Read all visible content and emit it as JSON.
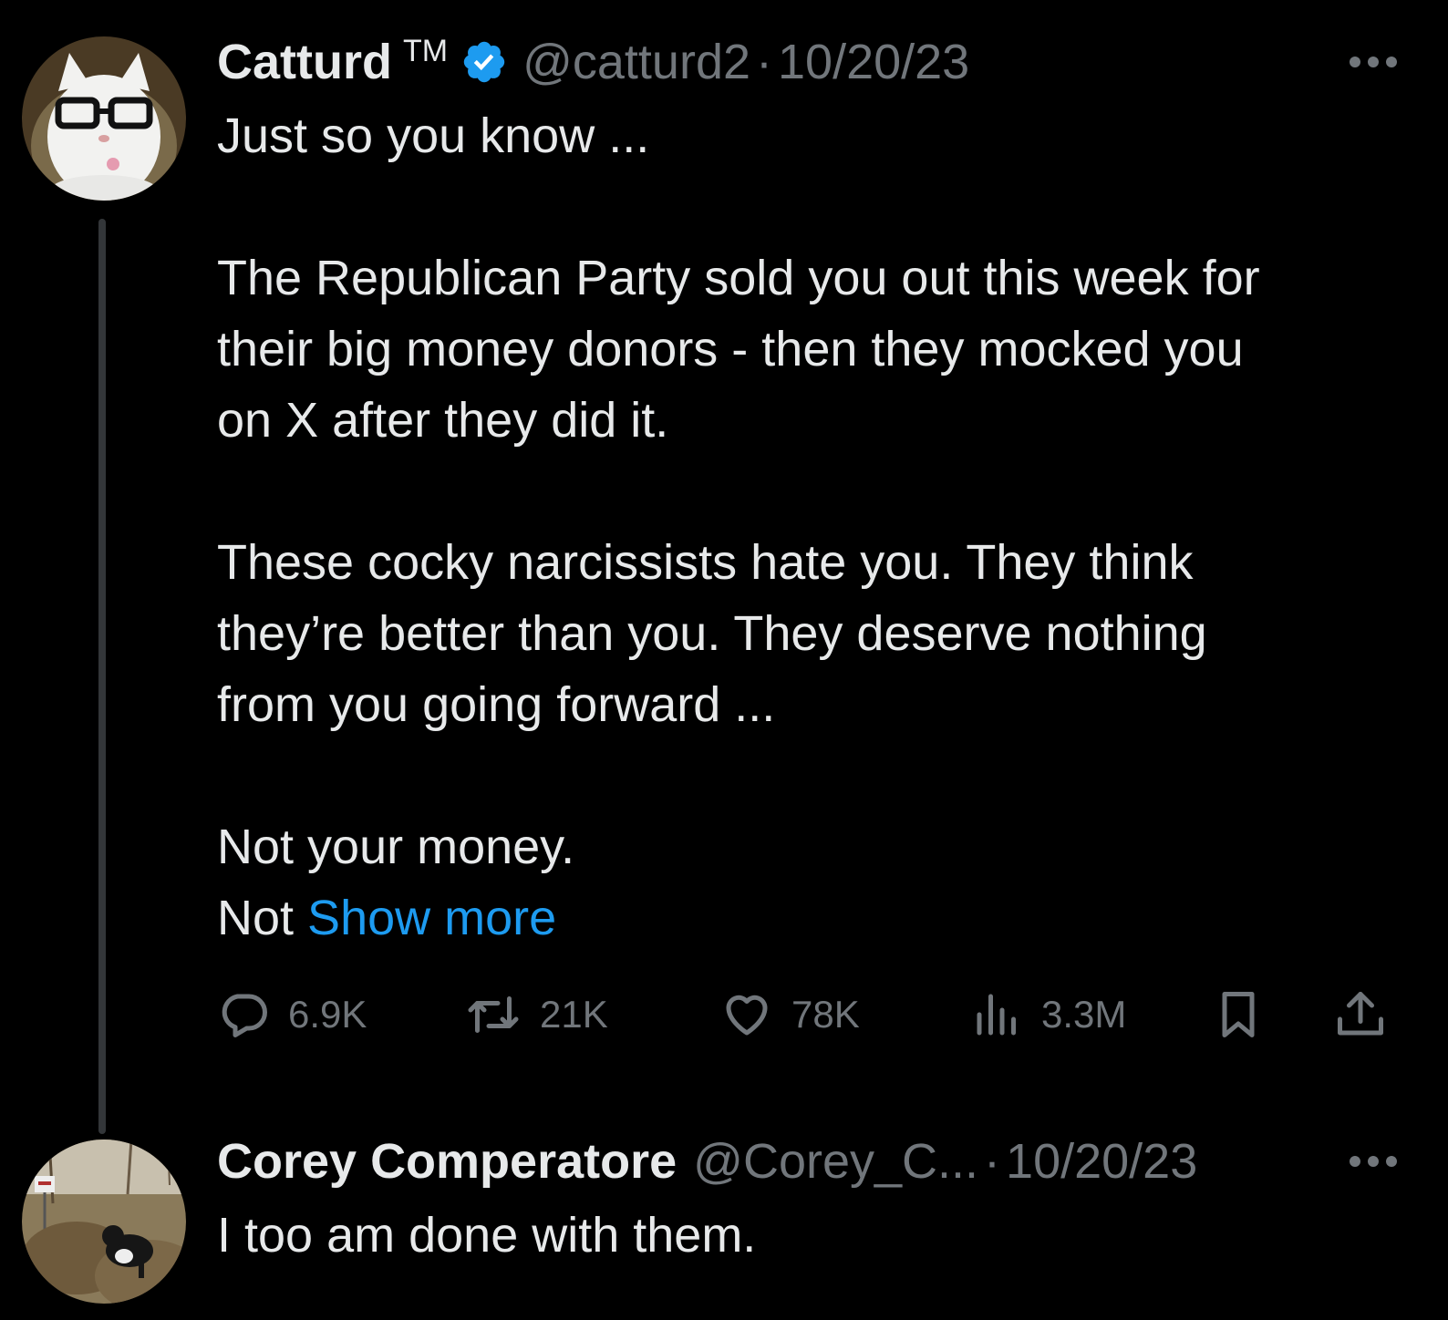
{
  "tweet": {
    "display_name": "Catturd",
    "trademark": "TM",
    "handle": "@catturd2",
    "separator": "·",
    "date": "10/20/23",
    "lines": [
      "Just so you know ...",
      "",
      "The Republican Party sold you out this week for",
      "their big money donors -  then they mocked you",
      "on X after they did it.",
      "",
      "These cocky narcissists hate you. They think",
      "they’re better than you. They deserve nothing",
      "from you going forward ...",
      "",
      "Not your money."
    ],
    "last_line_prefix": "Not ",
    "show_more": "Show more",
    "replies": "6.9K",
    "reposts": "21K",
    "likes": "78K",
    "views": "3.3M"
  },
  "reply": {
    "display_name": "Corey Comperatore",
    "handle": "@Corey_C...",
    "separator": "·",
    "date": "10/20/23",
    "text": "I too am done with them."
  },
  "colors": {
    "background": "#000000",
    "text": "#e7e9ea",
    "secondary": "#71767b",
    "link": "#1d9bf0",
    "verified": "#1d9bf0"
  }
}
